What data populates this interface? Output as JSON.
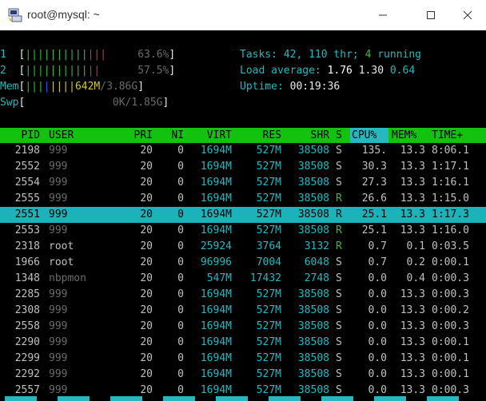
{
  "window": {
    "title": "root@mysql: ~",
    "minimize": "—",
    "maximize": "☐",
    "close": "✕"
  },
  "meters": {
    "cpu1": {
      "label": "1",
      "bars_green": "||||||||||",
      "bars_red": "|||",
      "value": "63.6%"
    },
    "cpu2": {
      "label": "2",
      "bars_green": "||||||||||",
      "bars_red": "||",
      "value": "57.5%"
    },
    "mem": {
      "label": "Mem",
      "bars_green": "|||",
      "bars_blue": "|",
      "bars_yellow": "||||",
      "value_used": "642M",
      "value_total": "/3.86G"
    },
    "swp": {
      "label": "Swp",
      "value": "0K/1.85G"
    }
  },
  "summary": {
    "tasks_label": "Tasks:",
    "tasks": "42,",
    "threads": "110",
    "thr_label": "thr;",
    "running": "4",
    "running_label": "running",
    "load_label": "Load average:",
    "load1": "1.76",
    "load5": "1.30",
    "load15": "0.64",
    "uptime_label": "Uptime:",
    "uptime": "00:19:36"
  },
  "columns": {
    "pid": "PID",
    "user": "USER",
    "pri": "PRI",
    "ni": "NI",
    "virt": "VIRT",
    "res": "RES",
    "shr": "SHR",
    "s": "S",
    "cpu": "CPU%",
    "mem": "MEM%",
    "time": "TIME+"
  },
  "processes": [
    {
      "pid": "2198",
      "user": "999",
      "pri": "20",
      "ni": "0",
      "virt": "1694M",
      "res": "527M",
      "shr": "38508",
      "s": "S",
      "cpu": "135.",
      "mem": "13.3",
      "time": "8:06.1"
    },
    {
      "pid": "2552",
      "user": "999",
      "pri": "20",
      "ni": "0",
      "virt": "1694M",
      "res": "527M",
      "shr": "38508",
      "s": "S",
      "cpu": "30.3",
      "mem": "13.3",
      "time": "1:17.1"
    },
    {
      "pid": "2554",
      "user": "999",
      "pri": "20",
      "ni": "0",
      "virt": "1694M",
      "res": "527M",
      "shr": "38508",
      "s": "S",
      "cpu": "27.3",
      "mem": "13.3",
      "time": "1:16.1"
    },
    {
      "pid": "2555",
      "user": "999",
      "pri": "20",
      "ni": "0",
      "virt": "1694M",
      "res": "527M",
      "shr": "38508",
      "s": "R",
      "cpu": "26.6",
      "mem": "13.3",
      "time": "1:15.0"
    },
    {
      "pid": "2551",
      "user": "999",
      "pri": "20",
      "ni": "0",
      "virt": "1694M",
      "res": "527M",
      "shr": "38508",
      "s": "R",
      "cpu": "25.1",
      "mem": "13.3",
      "time": "1:17.3",
      "selected": true
    },
    {
      "pid": "2553",
      "user": "999",
      "pri": "20",
      "ni": "0",
      "virt": "1694M",
      "res": "527M",
      "shr": "38508",
      "s": "R",
      "cpu": "25.1",
      "mem": "13.3",
      "time": "1:16.0"
    },
    {
      "pid": "2318",
      "user": "root",
      "pri": "20",
      "ni": "0",
      "virt": "25924",
      "res": "3764",
      "shr": "3132",
      "s": "R",
      "cpu": "0.7",
      "mem": "0.1",
      "time": "0:03.5"
    },
    {
      "pid": "1966",
      "user": "root",
      "pri": "20",
      "ni": "0",
      "virt": "96996",
      "res": "7004",
      "shr": "6048",
      "s": "S",
      "cpu": "0.7",
      "mem": "0.2",
      "time": "0:00.1"
    },
    {
      "pid": "1348",
      "user": "nbpmon",
      "pri": "20",
      "ni": "0",
      "virt": "547M",
      "res": "17432",
      "shr": "2748",
      "s": "S",
      "cpu": "0.0",
      "mem": "0.4",
      "time": "0:00.3"
    },
    {
      "pid": "2285",
      "user": "999",
      "pri": "20",
      "ni": "0",
      "virt": "1694M",
      "res": "527M",
      "shr": "38508",
      "s": "S",
      "cpu": "0.0",
      "mem": "13.3",
      "time": "0:00.3"
    },
    {
      "pid": "2308",
      "user": "999",
      "pri": "20",
      "ni": "0",
      "virt": "1694M",
      "res": "527M",
      "shr": "38508",
      "s": "S",
      "cpu": "0.0",
      "mem": "13.3",
      "time": "0:00.2"
    },
    {
      "pid": "2558",
      "user": "999",
      "pri": "20",
      "ni": "0",
      "virt": "1694M",
      "res": "527M",
      "shr": "38508",
      "s": "S",
      "cpu": "0.0",
      "mem": "13.3",
      "time": "0:00.3"
    },
    {
      "pid": "2290",
      "user": "999",
      "pri": "20",
      "ni": "0",
      "virt": "1694M",
      "res": "527M",
      "shr": "38508",
      "s": "S",
      "cpu": "0.0",
      "mem": "13.3",
      "time": "0:00.1"
    },
    {
      "pid": "2299",
      "user": "999",
      "pri": "20",
      "ni": "0",
      "virt": "1694M",
      "res": "527M",
      "shr": "38508",
      "s": "S",
      "cpu": "0.0",
      "mem": "13.3",
      "time": "0:00.1"
    },
    {
      "pid": "2292",
      "user": "999",
      "pri": "20",
      "ni": "0",
      "virt": "1694M",
      "res": "527M",
      "shr": "38508",
      "s": "S",
      "cpu": "0.0",
      "mem": "13.3",
      "time": "0:00.1"
    },
    {
      "pid": "2557",
      "user": "999",
      "pri": "20",
      "ni": "0",
      "virt": "1694M",
      "res": "527M",
      "shr": "38508",
      "s": "S",
      "cpu": "0.0",
      "mem": "13.3",
      "time": "0:00.3"
    }
  ],
  "colors": {
    "header_bg": "#13c20f",
    "selected_bg": "#1cb2b9",
    "cyan": "#26b7bf",
    "green": "#2fbf3a"
  },
  "icons": {
    "app": "putty-icon"
  }
}
